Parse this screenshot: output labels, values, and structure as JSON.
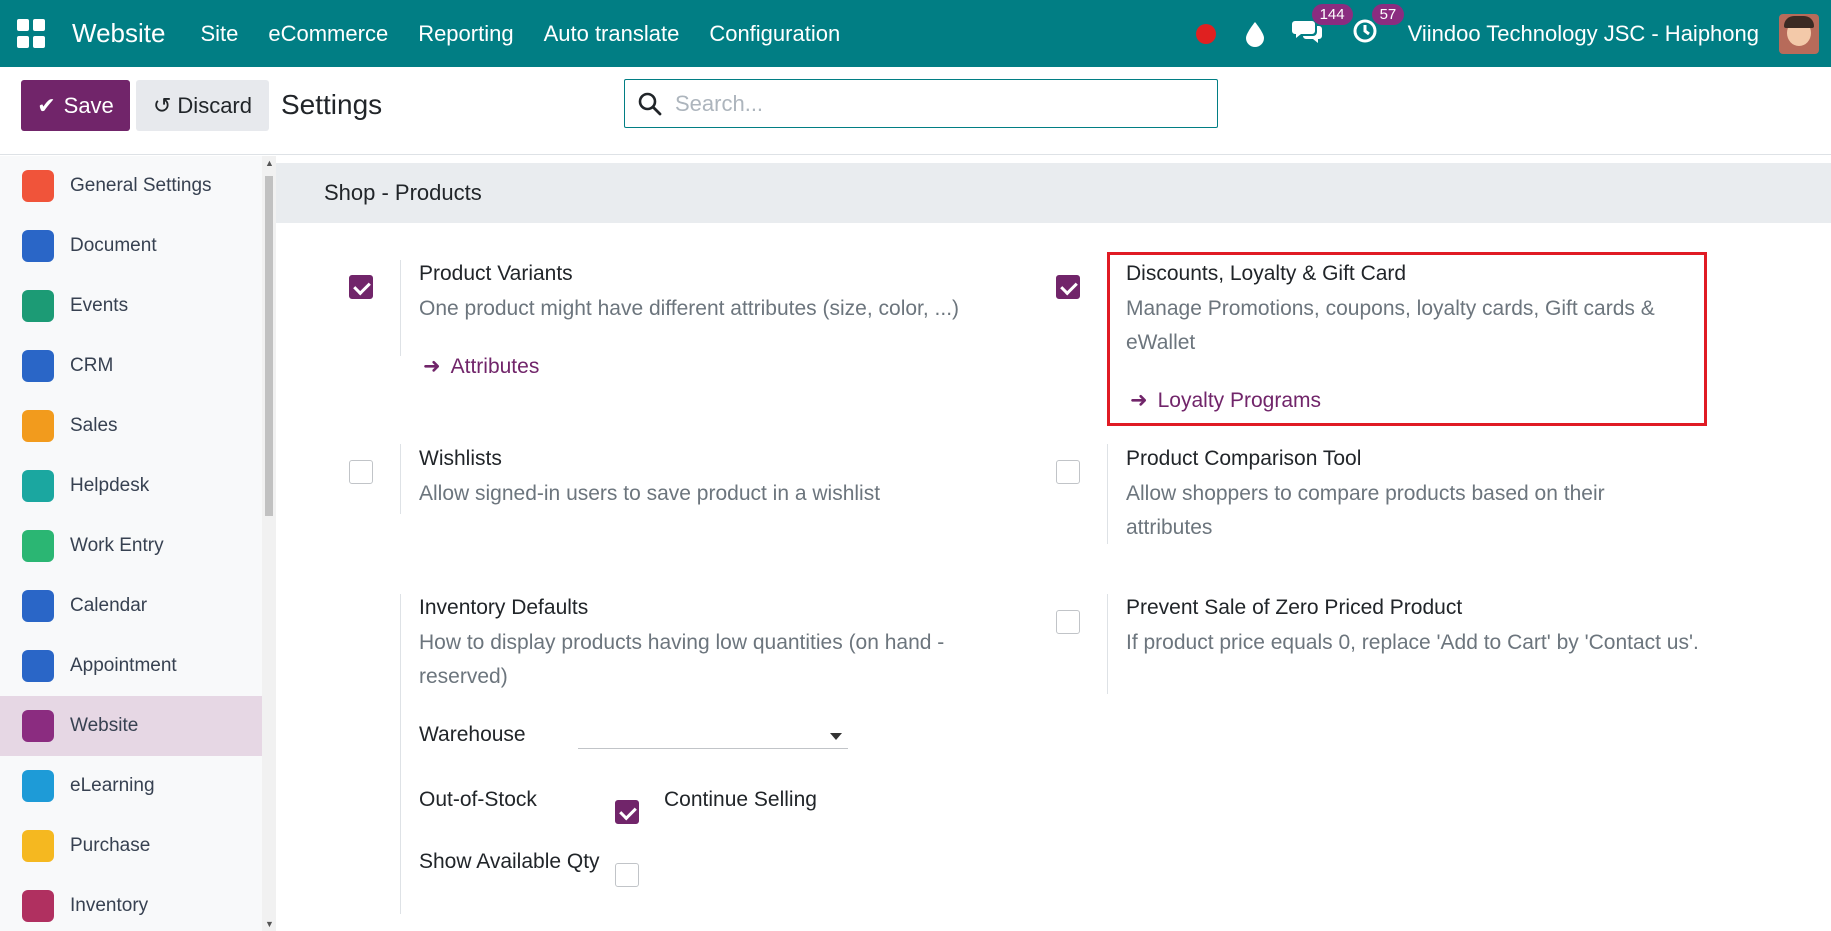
{
  "topnav": {
    "brand": "Website",
    "menu": [
      "Site",
      "eCommerce",
      "Reporting",
      "Auto translate",
      "Configuration"
    ],
    "messages_count": "144",
    "activities_count": "57",
    "company": "Viindoo Technology JSC - Haiphong"
  },
  "control": {
    "save_label": "Save",
    "discard_label": "Discard",
    "title": "Settings",
    "search_placeholder": "Search..."
  },
  "sidebar": {
    "items": [
      {
        "label": "General Settings",
        "icon": "general-settings-icon",
        "color": "#f0543a"
      },
      {
        "label": "Document",
        "icon": "folder-icon",
        "color": "#2a66c7"
      },
      {
        "label": "Events",
        "icon": "events-icon",
        "color": "#1c9b75"
      },
      {
        "label": "CRM",
        "icon": "crm-icon",
        "color": "#2a66c7"
      },
      {
        "label": "Sales",
        "icon": "sales-icon",
        "color": "#f29b1d"
      },
      {
        "label": "Helpdesk",
        "icon": "helpdesk-icon",
        "color": "#1ba7a0"
      },
      {
        "label": "Work Entry",
        "icon": "work-entry-icon",
        "color": "#2bb673"
      },
      {
        "label": "Calendar",
        "icon": "calendar-icon",
        "color": "#2a66c7"
      },
      {
        "label": "Appointment",
        "icon": "appointment-icon",
        "color": "#2a66c7"
      },
      {
        "label": "Website",
        "icon": "website-icon",
        "color": "#8b2c80",
        "active": true
      },
      {
        "label": "eLearning",
        "icon": "elearning-icon",
        "color": "#1e9bd7"
      },
      {
        "label": "Purchase",
        "icon": "purchase-icon",
        "color": "#f5b820"
      },
      {
        "label": "Inventory",
        "icon": "inventory-icon",
        "color": "#b03060"
      }
    ]
  },
  "section": {
    "title": "Shop - Products"
  },
  "settings": {
    "variants": {
      "title": "Product Variants",
      "desc": "One product might have different attributes (size, color, ...)",
      "link": "Attributes",
      "checked": true
    },
    "discounts": {
      "title": "Discounts, Loyalty & Gift Card",
      "desc": "Manage Promotions, coupons, loyalty cards, Gift cards & eWallet",
      "link": "Loyalty Programs",
      "checked": true
    },
    "wishlists": {
      "title": "Wishlists",
      "desc": "Allow signed-in users to save product in a wishlist",
      "checked": false
    },
    "comparison": {
      "title": "Product Comparison Tool",
      "desc": "Allow shoppers to compare products based on their attributes",
      "checked": false
    },
    "inventory": {
      "title": "Inventory Defaults",
      "desc": "How to display products having low quantities (on hand - reserved)",
      "warehouse_label": "Warehouse",
      "warehouse_value": "",
      "oos_label": "Out-of-Stock",
      "continue_label": "Continue Selling",
      "continue_checked": true,
      "show_qty_label": "Show Available Qty",
      "show_qty_checked": false
    },
    "zero_price": {
      "title": "Prevent Sale of Zero Priced Product",
      "desc": "If product price equals 0, replace 'Add to Cart' by 'Contact us'.",
      "checked": false
    }
  },
  "colors": {
    "navbar": "#017e84",
    "primary": "#71256a",
    "highlight": "#e01b24"
  }
}
